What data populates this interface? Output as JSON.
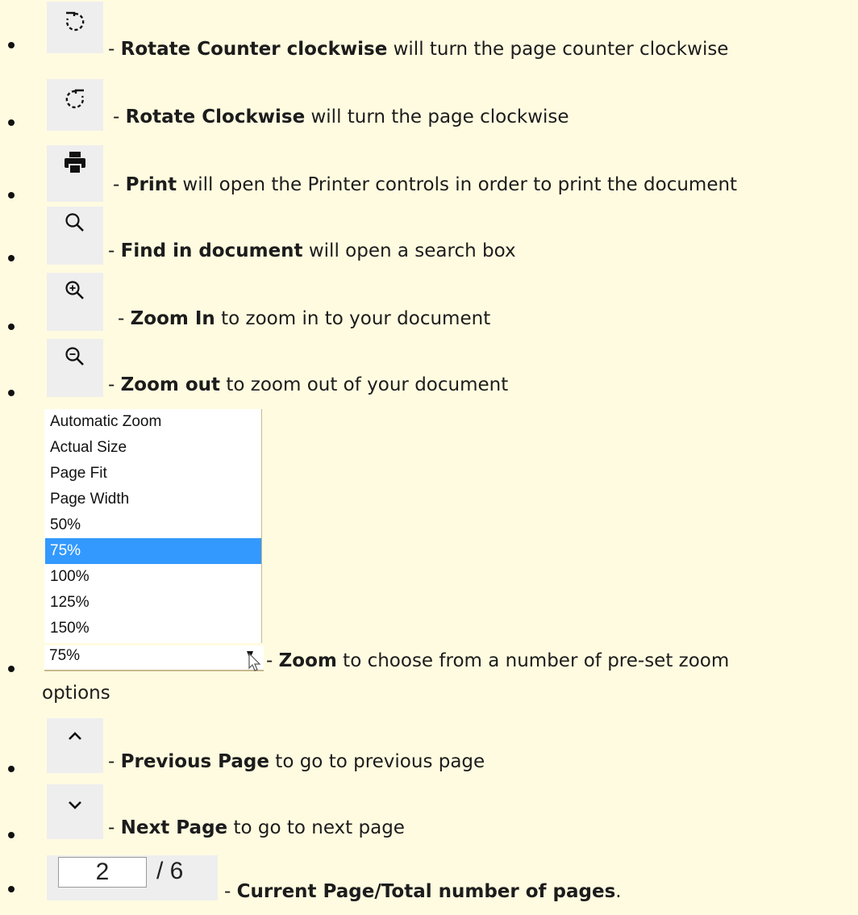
{
  "items": [
    {
      "icon": "rotate-counterclockwise-icon",
      "label": "Rotate Counter clockwise",
      "rest": " will turn the page counter clockwise"
    },
    {
      "icon": "rotate-clockwise-icon",
      "label": "Rotate Clockwise",
      "rest": " will turn the page clockwise"
    },
    {
      "icon": "printer-icon",
      "label": "Print",
      "rest": " will open the Printer controls in order to print the document"
    },
    {
      "icon": "search-icon",
      "label": "Find in document",
      "rest": " will open a search box"
    },
    {
      "icon": "zoom-in-icon",
      "label": "Zoom In",
      "rest": " to zoom in to your document"
    },
    {
      "icon": "zoom-out-icon",
      "label": "Zoom out",
      "rest": " to zoom out of your document"
    },
    {
      "icon": "zoom-select",
      "label": "Zoom",
      "rest": " to choose from a number of pre-set zoom",
      "rest2": "options"
    },
    {
      "icon": "chevron-up-icon",
      "label": "Previous Page",
      "rest": " to go to previous page"
    },
    {
      "icon": "chevron-down-icon",
      "label": "Next Page",
      "rest": " to go to next page"
    },
    {
      "icon": "page-number-field",
      "label": "Current Page/Total number of pages",
      "rest": "."
    }
  ],
  "separator": "- ",
  "zoom_dropdown": {
    "options": [
      "Automatic Zoom",
      "Actual Size",
      "Page Fit",
      "Page Width",
      "50%",
      "75%",
      "100%",
      "125%",
      "150%"
    ],
    "selected": "75%"
  },
  "page_field": {
    "current": "2",
    "total": "/ 6"
  },
  "colors": {
    "background": "#fffbe0",
    "icon_box": "#eeeeee",
    "selected_option": "#3399ff"
  }
}
